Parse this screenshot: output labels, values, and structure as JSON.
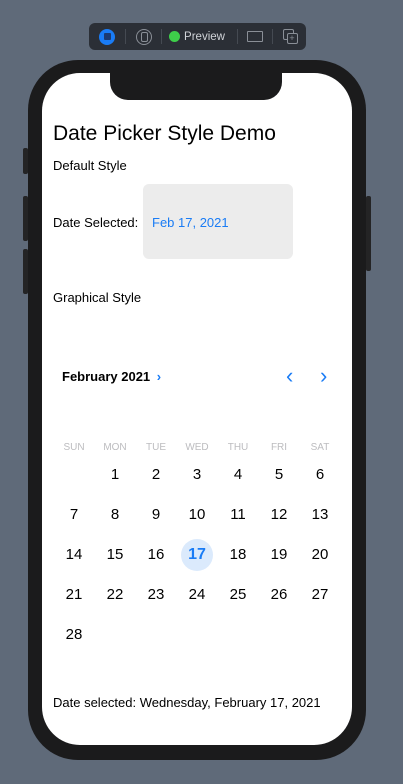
{
  "toolbar": {
    "live_icon": "live-preview-icon",
    "device_icon": "device-icon",
    "preview_label": "Preview",
    "status_color": "#3ecf4a",
    "display_icon": "display-icon",
    "duplicate_icon": "duplicate-icon"
  },
  "screen": {
    "title": "Date Picker Style Demo",
    "default_style_label": "Default Style",
    "date_selected_label": "Date Selected:",
    "date_selected_value": "Feb 17, 2021",
    "graphical_style_label": "Graphical Style",
    "calendar": {
      "month_label": "February 2021",
      "weekdays": [
        "SUN",
        "MON",
        "TUE",
        "WED",
        "THU",
        "FRI",
        "SAT"
      ],
      "weeks": [
        [
          "",
          "1",
          "2",
          "3",
          "4",
          "5",
          "6"
        ],
        [
          "7",
          "8",
          "9",
          "10",
          "11",
          "12",
          "13"
        ],
        [
          "14",
          "15",
          "16",
          "17",
          "18",
          "19",
          "20"
        ],
        [
          "21",
          "22",
          "23",
          "24",
          "25",
          "26",
          "27"
        ],
        [
          "28",
          "",
          "",
          "",
          "",
          "",
          ""
        ]
      ],
      "selected_day": "17",
      "accent_color": "#1a7cf5"
    },
    "footer_text": "Date selected: Wednesday, February 17, 2021"
  }
}
